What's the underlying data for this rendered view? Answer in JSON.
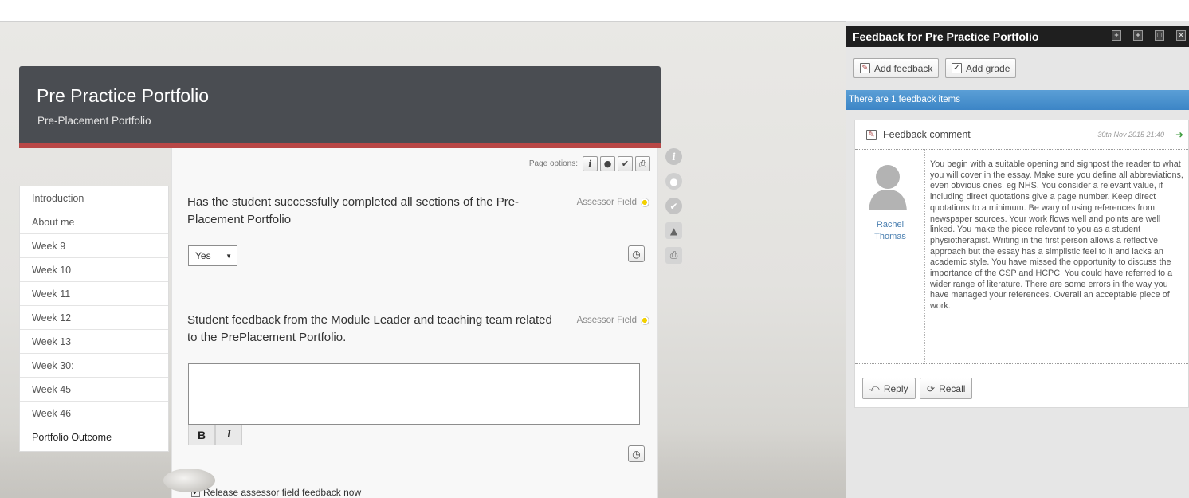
{
  "portfolio": {
    "title": "Pre Practice Portfolio",
    "subtitle": "Pre-Placement Portfolio"
  },
  "nav": {
    "items": [
      {
        "label": "Introduction"
      },
      {
        "label": "About me"
      },
      {
        "label": "Week 9"
      },
      {
        "label": "Week 10"
      },
      {
        "label": "Week 11"
      },
      {
        "label": "Week 12"
      },
      {
        "label": "Week 13"
      },
      {
        "label": "Week 30:"
      },
      {
        "label": "Week 45"
      },
      {
        "label": "Week 46"
      },
      {
        "label": "Portfolio Outcome"
      }
    ]
  },
  "page_options": {
    "label": "Page options:",
    "icons": [
      "info-icon",
      "comment-icon",
      "check-icon",
      "print-icon"
    ]
  },
  "fields": [
    {
      "question": "Has the student successfully completed all sections of the Pre-Placement Portfolio",
      "assessor_label": "Assessor Field",
      "selected_value": "Yes"
    },
    {
      "question": "Student feedback from the Module Leader and teaching team related to the PrePlacement Portfolio.",
      "assessor_label": "Assessor Field",
      "bold_label": "B",
      "italic_label": "I"
    }
  ],
  "release": {
    "label": "Release assessor field feedback now",
    "checked": true
  },
  "side_icons": [
    "info-circle-icon",
    "comment-circle-icon",
    "check-circle-icon",
    "thumbs-up-icon",
    "print-icon"
  ],
  "feedback_panel": {
    "title": "Feedback for Pre Practice Portfolio",
    "add_feedback_label": "Add feedback",
    "add_grade_label": "Add grade",
    "info": "There are 1 feedback items",
    "item": {
      "title": "Feedback comment",
      "date": "30th Nov 2015 21:40",
      "author_first": "Rachel",
      "author_last": "Thomas",
      "text": "You begin with a suitable opening and signpost the reader to what you will cover in the essay. Make sure you define all abbreviations, even obvious ones, eg NHS. You consider a relevant value, if including direct quotations give a page number. Keep direct quotations to a minimum. Be wary of using references from newspaper sources. Your work flows well and points are well linked. You make the piece relevant to you as a student physiotherapist. Writing in the first person allows a reflective approach but the essay has a simplistic feel to it and lacks an academic style. You have missed the opportunity to discuss the importance of the CSP and HCPC. You could have referred to a wider range of literature. There are some errors in the way you have managed your references.  Overall an acceptable piece of work.",
      "reply_label": "Reply",
      "recall_label": "Recall"
    }
  },
  "colors": {
    "header_bg": "#4a4d52",
    "header_accent": "#b94746",
    "info_bar": "#3c85c6",
    "author_link": "#4a7fb0"
  }
}
